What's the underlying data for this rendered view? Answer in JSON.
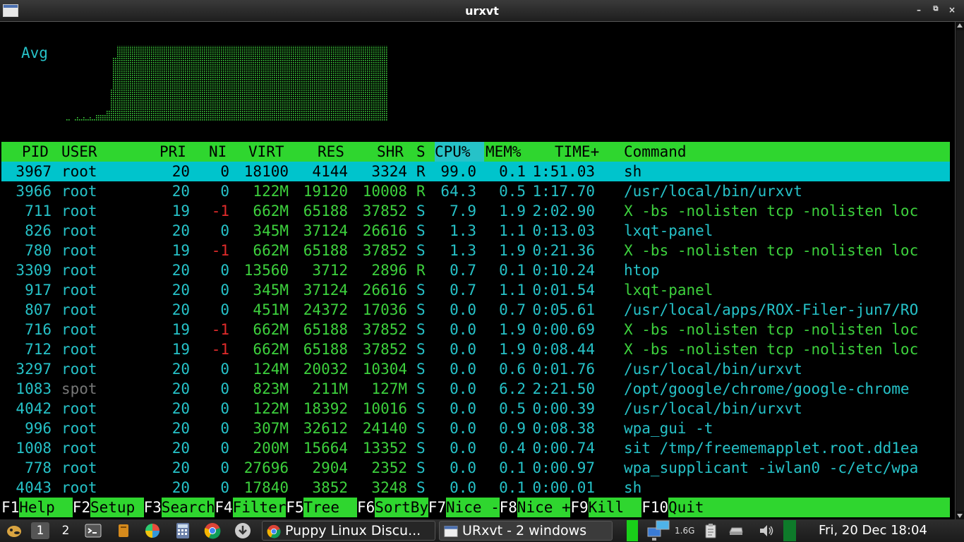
{
  "window": {
    "title": "urxvt"
  },
  "meter": {
    "label": "Avg",
    "color": "#3dd13d"
  },
  "header": {
    "pid": "PID",
    "user": "USER",
    "pri": "PRI",
    "ni": "NI",
    "virt": "VIRT",
    "res": "RES",
    "shr": "SHR",
    "s": "S",
    "cpu": "CPU%",
    "mem": "MEM%",
    "time": "TIME+",
    "command": "Command"
  },
  "processes": [
    {
      "pid": "3967",
      "user": "root",
      "pri": "20",
      "ni": "0",
      "virt": "18100",
      "res": "4144",
      "shr": "3324",
      "s": "R",
      "cpu": "99.0",
      "mem": "0.1",
      "time": "1:51.03",
      "command": "sh",
      "selected": true
    },
    {
      "pid": "3966",
      "user": "root",
      "pri": "20",
      "ni": "0",
      "virt": "122M",
      "res": "19120",
      "shr": "10008",
      "s": "R",
      "cpu": "64.3",
      "mem": "0.5",
      "time": "1:17.70",
      "command": "/usr/local/bin/urxvt"
    },
    {
      "pid": "711",
      "user": "root",
      "pri": "19",
      "ni": "-1",
      "virt": "662M",
      "res": "65188",
      "shr": "37852",
      "s": "S",
      "cpu": "7.9",
      "mem": "1.9",
      "time": "2:02.90",
      "command": "X -bs -nolisten tcp -nolisten loc"
    },
    {
      "pid": "826",
      "user": "root",
      "pri": "20",
      "ni": "0",
      "virt": "345M",
      "res": "37124",
      "shr": "26616",
      "s": "S",
      "cpu": "1.3",
      "mem": "1.1",
      "time": "0:13.03",
      "command": "lxqt-panel"
    },
    {
      "pid": "780",
      "user": "root",
      "pri": "19",
      "ni": "-1",
      "virt": "662M",
      "res": "65188",
      "shr": "37852",
      "s": "S",
      "cpu": "1.3",
      "mem": "1.9",
      "time": "0:21.36",
      "command": "X -bs -nolisten tcp -nolisten loc"
    },
    {
      "pid": "3309",
      "user": "root",
      "pri": "20",
      "ni": "0",
      "virt": "13560",
      "res": "3712",
      "shr": "2896",
      "s": "R",
      "cpu": "0.7",
      "mem": "0.1",
      "time": "0:10.24",
      "command": "htop"
    },
    {
      "pid": "917",
      "user": "root",
      "pri": "20",
      "ni": "0",
      "virt": "345M",
      "res": "37124",
      "shr": "26616",
      "s": "S",
      "cpu": "0.7",
      "mem": "1.1",
      "time": "0:01.54",
      "command": "lxqt-panel"
    },
    {
      "pid": "807",
      "user": "root",
      "pri": "20",
      "ni": "0",
      "virt": "451M",
      "res": "24372",
      "shr": "17036",
      "s": "S",
      "cpu": "0.0",
      "mem": "0.7",
      "time": "0:05.61",
      "command": "/usr/local/apps/ROX-Filer-jun7/RO"
    },
    {
      "pid": "716",
      "user": "root",
      "pri": "19",
      "ni": "-1",
      "virt": "662M",
      "res": "65188",
      "shr": "37852",
      "s": "S",
      "cpu": "0.0",
      "mem": "1.9",
      "time": "0:00.69",
      "command": "X -bs -nolisten tcp -nolisten loc"
    },
    {
      "pid": "712",
      "user": "root",
      "pri": "19",
      "ni": "-1",
      "virt": "662M",
      "res": "65188",
      "shr": "37852",
      "s": "S",
      "cpu": "0.0",
      "mem": "1.9",
      "time": "0:08.44",
      "command": "X -bs -nolisten tcp -nolisten loc"
    },
    {
      "pid": "3297",
      "user": "root",
      "pri": "20",
      "ni": "0",
      "virt": "124M",
      "res": "20032",
      "shr": "10304",
      "s": "S",
      "cpu": "0.0",
      "mem": "0.6",
      "time": "0:01.76",
      "command": "/usr/local/bin/urxvt"
    },
    {
      "pid": "1083",
      "user": "spot",
      "pri": "20",
      "ni": "0",
      "virt": "823M",
      "res": "211M",
      "shr": "127M",
      "s": "S",
      "cpu": "0.0",
      "mem": "6.2",
      "time": "2:21.50",
      "command": "/opt/google/chrome/google-chrome"
    },
    {
      "pid": "4042",
      "user": "root",
      "pri": "20",
      "ni": "0",
      "virt": "122M",
      "res": "18392",
      "shr": "10016",
      "s": "S",
      "cpu": "0.0",
      "mem": "0.5",
      "time": "0:00.39",
      "command": "/usr/local/bin/urxvt"
    },
    {
      "pid": "996",
      "user": "root",
      "pri": "20",
      "ni": "0",
      "virt": "307M",
      "res": "32612",
      "shr": "24140",
      "s": "S",
      "cpu": "0.0",
      "mem": "0.9",
      "time": "0:08.38",
      "command": "wpa_gui -t"
    },
    {
      "pid": "1008",
      "user": "root",
      "pri": "20",
      "ni": "0",
      "virt": "200M",
      "res": "15664",
      "shr": "13352",
      "s": "S",
      "cpu": "0.0",
      "mem": "0.4",
      "time": "0:00.74",
      "command": "sit /tmp/freememapplet.root.dd1ea"
    },
    {
      "pid": "778",
      "user": "root",
      "pri": "20",
      "ni": "0",
      "virt": "27696",
      "res": "2904",
      "shr": "2352",
      "s": "S",
      "cpu": "0.0",
      "mem": "0.1",
      "time": "0:00.97",
      "command": "wpa_supplicant -iwlan0 -c/etc/wpa"
    },
    {
      "pid": "4043",
      "user": "root",
      "pri": "20",
      "ni": "0",
      "virt": "17840",
      "res": "3852",
      "shr": "3248",
      "s": "S",
      "cpu": "0.0",
      "mem": "0.1",
      "time": "0:00.01",
      "command": "sh"
    }
  ],
  "fkeys": [
    {
      "key": "F1",
      "label": "Help"
    },
    {
      "key": "F2",
      "label": "Setup"
    },
    {
      "key": "F3",
      "label": "Search"
    },
    {
      "key": "F4",
      "label": "Filter"
    },
    {
      "key": "F5",
      "label": "Tree"
    },
    {
      "key": "F6",
      "label": "SortBy"
    },
    {
      "key": "F7",
      "label": "Nice -"
    },
    {
      "key": "F8",
      "label": "Nice +"
    },
    {
      "key": "F9",
      "label": "Kill"
    },
    {
      "key": "F10",
      "label": "Quit"
    }
  ],
  "taskbar": {
    "desktops": [
      "1",
      "2"
    ],
    "tasks": [
      {
        "label": "Puppy Linux Discu...",
        "icon": "chrome-icon"
      },
      {
        "label": "URxvt - 2 windows",
        "icon": "terminal-window-icon"
      }
    ],
    "memory": "1.6G",
    "clock": "Fri, 20 Dec 18:04"
  },
  "colors": {
    "cyan": "#26c2c8",
    "green": "#3dd13d",
    "red": "#e12b2b",
    "selected_bg": "#00c4cc",
    "header_bg": "#2fd62f"
  }
}
